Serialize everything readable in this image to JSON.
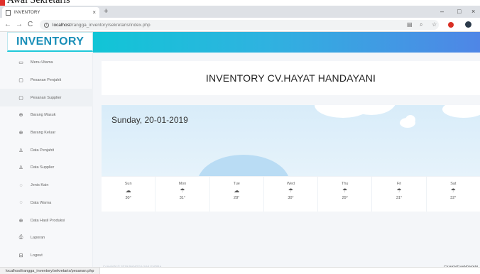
{
  "caption": "Awal Sekretaris",
  "browser": {
    "tab_title": "INVENTORY",
    "tab_close": "×",
    "new_tab": "+",
    "back": "←",
    "forward": "→",
    "reload": "C",
    "address_host": "localhost",
    "address_path": "/rangga_inventory/sekretaris/index.php",
    "window_controls": {
      "minimize": "–",
      "maximize": "□",
      "close": "×"
    }
  },
  "sidebar": {
    "brand": "INVENTORY",
    "items": [
      {
        "icon": "monitor-icon",
        "glyph": "▭",
        "label": "Menu Utama",
        "active": false
      },
      {
        "icon": "chat-icon",
        "glyph": "▢",
        "label": "Pesanan Penjahit",
        "active": false
      },
      {
        "icon": "chat-icon",
        "glyph": "▢",
        "label": "Pesanan Supplier",
        "active": true
      },
      {
        "icon": "box-icon",
        "glyph": "⊕",
        "label": "Barang Masuk",
        "active": false
      },
      {
        "icon": "box-icon",
        "glyph": "⊕",
        "label": "Barang Keluar",
        "active": false
      },
      {
        "icon": "user-icon",
        "glyph": "♙",
        "label": "Data Penjahit",
        "active": false
      },
      {
        "icon": "user-icon",
        "glyph": "♙",
        "label": "Data Supplier",
        "active": false
      },
      {
        "icon": "circle-icon",
        "glyph": "◌",
        "label": "Jenis Kain",
        "active": false
      },
      {
        "icon": "circle-icon",
        "glyph": "◌",
        "label": "Data Warna",
        "active": false
      },
      {
        "icon": "box-icon",
        "glyph": "⊕",
        "label": "Data Hasil Produksi",
        "active": false
      },
      {
        "icon": "printer-icon",
        "glyph": "⎙",
        "label": "Laporan",
        "active": false
      },
      {
        "icon": "logout-icon",
        "glyph": "⊟",
        "label": "Logout",
        "active": false
      }
    ]
  },
  "main": {
    "title": "INVENTORY CV.HAYAT HANDAYANI",
    "date": "Sunday, 20-01-2019",
    "forecast": [
      {
        "day": "Sun",
        "icon": "cloud-icon",
        "glyph": "☁",
        "temp": "30°"
      },
      {
        "day": "Mon",
        "icon": "cloud-rain-icon",
        "glyph": "☂",
        "temp": "31°"
      },
      {
        "day": "Tue",
        "icon": "cloud-storm-icon",
        "glyph": "☁",
        "temp": "28°"
      },
      {
        "day": "Wed",
        "icon": "cloud-rain-icon",
        "glyph": "☂",
        "temp": "30°"
      },
      {
        "day": "Thu",
        "icon": "cloud-rain-icon",
        "glyph": "☂",
        "temp": "29°"
      },
      {
        "day": "Fri",
        "icon": "cloud-rain-icon",
        "glyph": "☂",
        "temp": "31°"
      },
      {
        "day": "Sat",
        "icon": "cloud-rain-icon",
        "glyph": "☂",
        "temp": "32°"
      }
    ]
  },
  "footer": {
    "left": "Copyright © 2019 RANGGA SAILENDRA",
    "right": "CV.HAYAT HANDAYANI"
  },
  "statusbar": {
    "url": "localhost/rangga_inventory/sekretaris/pesanan.php"
  },
  "colors": {
    "accent_start": "#11c5d6",
    "accent_end": "#4f86e6",
    "brand": "#1a8fb8"
  }
}
